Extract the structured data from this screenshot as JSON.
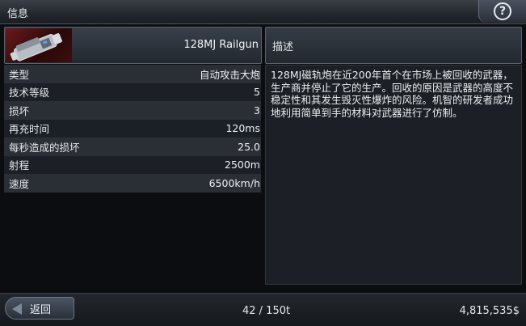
{
  "window": {
    "title": "信息"
  },
  "item": {
    "name": "128MJ Railgun",
    "stats": [
      {
        "label": "类型",
        "value": "自动攻击大炮"
      },
      {
        "label": "技术等级",
        "value": "5"
      },
      {
        "label": "损坏",
        "value": "3"
      },
      {
        "label": "再充时间",
        "value": "120ms"
      },
      {
        "label": "每秒造成的损坏",
        "value": "25.0"
      },
      {
        "label": "射程",
        "value": "2500m"
      },
      {
        "label": "速度",
        "value": "6500km/h"
      }
    ]
  },
  "description": {
    "title": "描述",
    "text": "128MJ磁轨炮在近200年首个在市场上被回收的武器，生产商并停止了它的生产。回收的原因是武器的高度不稳定性和其发生毁灭性爆炸的风险。机智的研发者成功地利用简单到手的材料对武器进行了仿制。"
  },
  "footer": {
    "back_label": "返回",
    "capacity": "42 / 150t",
    "money": "4,815,535$"
  },
  "icons": {
    "help": "help-icon",
    "back": "back-arrow-icon",
    "item": "railgun-icon"
  },
  "colors": {
    "accent_red": "#6a1a1a",
    "panel": "#2a2f36"
  }
}
